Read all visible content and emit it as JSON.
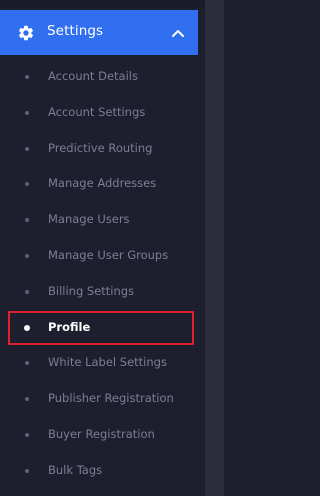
{
  "header": {
    "label": "Settings",
    "icon": "gear-icon",
    "chevron": "chevron-up-icon",
    "color": "#2f6ff0"
  },
  "menu": {
    "items": [
      {
        "label": "Account Details"
      },
      {
        "label": "Account Settings"
      },
      {
        "label": "Predictive Routing"
      },
      {
        "label": "Manage Addresses"
      },
      {
        "label": "Manage Users"
      },
      {
        "label": "Manage User Groups"
      },
      {
        "label": "Billing Settings"
      },
      {
        "label": "Profile"
      },
      {
        "label": "White Label Settings"
      },
      {
        "label": "Publisher Registration"
      },
      {
        "label": "Buyer Registration"
      },
      {
        "label": "Bulk Tags"
      }
    ],
    "active_index": 7,
    "highlight_color": "#e1202f"
  }
}
